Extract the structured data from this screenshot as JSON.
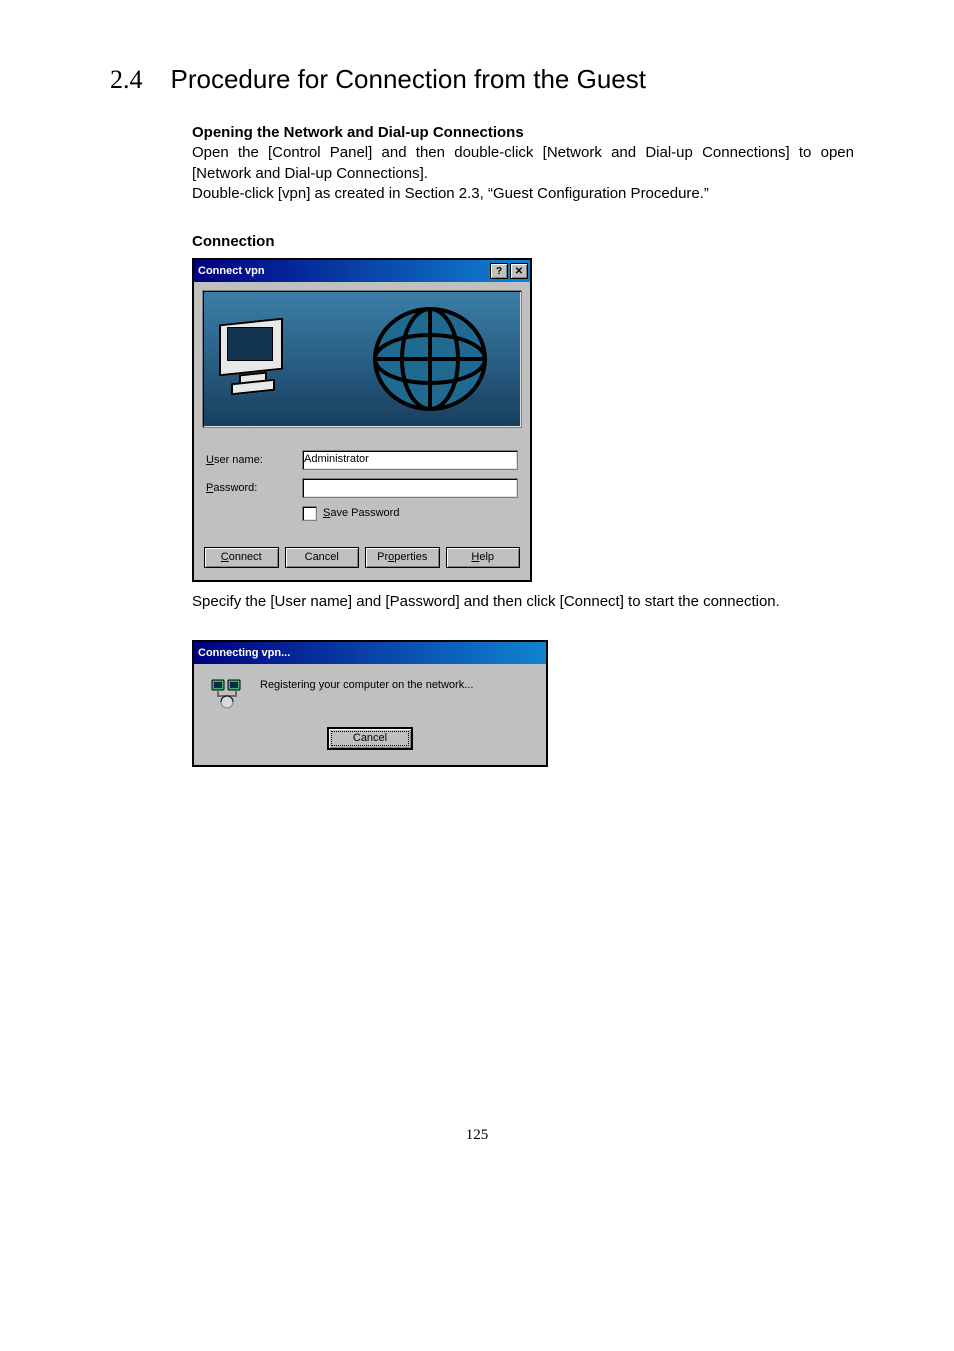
{
  "section": {
    "number": "2.4",
    "title": "Procedure for Connection from the Guest"
  },
  "opening": {
    "heading": "Opening the Network and Dial-up Connections",
    "p1": "Open the [Control Panel] and then double-click [Network and Dial-up Connections] to open [Network and Dial-up Connections].",
    "p2": "Double-click [vpn] as created in Section 2.3, “Guest Configuration Procedure.”"
  },
  "connect": {
    "section_label": "Connection",
    "title": "Connect vpn",
    "help_glyph": "?",
    "close_glyph": "✕",
    "labels": {
      "username_pre": "U",
      "username_rest": "ser name:",
      "password_pre": "P",
      "password_rest": "assword:",
      "save_pre": "S",
      "save_rest": "ave Password"
    },
    "values": {
      "username": "Administrator",
      "password": ""
    },
    "buttons": {
      "connect_pre": "C",
      "connect_rest": "onnect",
      "cancel": "Cancel",
      "properties_pre": "o",
      "properties_before": "Pr",
      "properties_after": "perties",
      "help_pre": "H",
      "help_rest": "elp"
    },
    "footnote": "Specify the [User name] and [Password] and then click [Connect] to start the connection."
  },
  "connecting": {
    "title": "Connecting vpn...",
    "status": "Registering your computer on the network...",
    "cancel": "Cancel"
  },
  "page_number": "125"
}
